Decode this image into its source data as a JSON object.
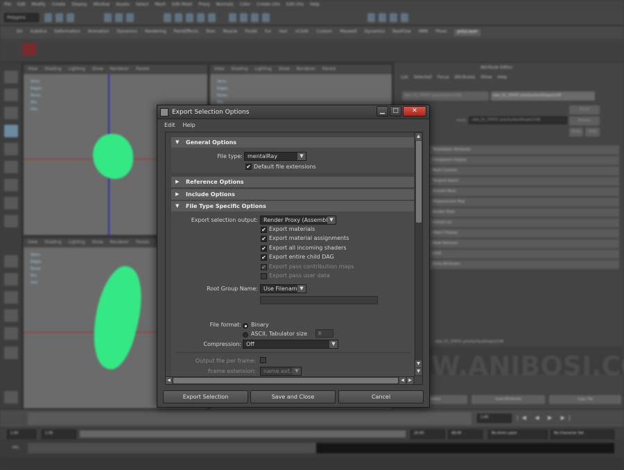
{
  "dialog": {
    "title": "Export Selection Options",
    "menu": [
      "Edit",
      "Help"
    ],
    "window_buttons": [
      "▁",
      "□",
      "✕"
    ],
    "sections": {
      "general": "General Options",
      "reference": "Reference Options",
      "include": "Include Options",
      "file_type_specific": "File Type Specific Options"
    },
    "general": {
      "file_type_label": "File type:",
      "file_type_value": "mentalRay",
      "default_extensions_label": "Default file extensions",
      "default_extensions_checked": true
    },
    "specific": {
      "export_output_label": "Export selection output:",
      "export_output_value": "Render Proxy (Assembly)",
      "checkboxes": [
        {
          "label": "Export materials",
          "checked": true,
          "enabled": true
        },
        {
          "label": "Export material assignments",
          "checked": true,
          "enabled": true
        },
        {
          "label": "Export all incoming shaders",
          "checked": true,
          "enabled": true
        },
        {
          "label": "Export entire child DAG",
          "checked": true,
          "enabled": true
        },
        {
          "label": "Export pass contribution maps",
          "checked": true,
          "enabled": false
        },
        {
          "label": "Export pass user data",
          "checked": false,
          "enabled": false
        }
      ],
      "root_group_label": "Root Group Name:",
      "root_group_value": "Use Filename",
      "file_format_label": "File format:",
      "format_binary": "Binary",
      "format_ascii": "ASCII, Tabulator size",
      "tabulator_size": "8",
      "compression_label": "Compression:",
      "compression_value": "Off",
      "output_per_frame_label": "Output file per frame:",
      "frame_extension_label": "Frame extension:",
      "frame_extension_value": "name.ext.#"
    },
    "buttons": {
      "export": "Export Selection",
      "save_close": "Save and Close",
      "cancel": "Cancel"
    }
  },
  "background": {
    "menubar": [
      "File",
      "Edit",
      "Modify",
      "Create",
      "Display",
      "Window",
      "Assets",
      "Select",
      "Mesh",
      "Edit Mesh",
      "Proxy",
      "Normals",
      "Color",
      "Create UVs",
      "Edit UVs",
      "Help"
    ],
    "status_mode": "Polygons",
    "shelf_tabs": [
      "Dir",
      "Subdivs",
      "Deformation",
      "Animation",
      "Dynamics",
      "Rendering",
      "PaintEffects",
      "Toon",
      "Muscle",
      "Fluids",
      "Fur",
      "Hair",
      "nCloth",
      "Custom",
      "Maxwell",
      "Dynamics",
      "RealFlow",
      "MRR",
      "Phoxi",
      "polyLayer"
    ],
    "active_shelf_tab": "polyLayer",
    "viewport_menu": [
      "View",
      "Shading",
      "Lighting",
      "Show",
      "Renderer",
      "Panels"
    ],
    "hud_labels": [
      "Verts:",
      "Edges:",
      "Faces:",
      "Tris:",
      "UVs:"
    ],
    "attribute_editor": {
      "title": "Attribute Editor",
      "menu": [
        "List",
        "Selected",
        "Focus",
        "Attributes",
        "Show",
        "Help"
      ],
      "tab_1": "obis_01_STATIC:polySurface2108",
      "tab_2": "obis_01_STATIC:polySurfaceShape2108",
      "shape_label": "mesh:",
      "shape_value": "obis_01_STATIC:polySurfaceShape2108",
      "rows": [
        "Tessellation Attributes",
        "Component Display",
        "Mesh Controls",
        "Tangent Space",
        "Smooth Mesh",
        "Displacement Map",
        "Render Stats",
        "mental ray",
        "Object Display",
        "Node Behavior",
        "UUID",
        "Extra Attributes"
      ],
      "bottom_buttons": [
        "Select",
        "Load Attributes",
        "Copy Tab"
      ],
      "node_label": "obis_01_STATIC:polySurfaceShape2108",
      "side_buttons": [
        "Focus",
        "Presets",
        "Show",
        "Hide"
      ]
    },
    "range": {
      "start": "1.00",
      "start2": "1.00",
      "current": "1.00",
      "end": "24.00",
      "end2": "48.00",
      "anim_layer": "No Anim Layer",
      "character": "No Character Set"
    },
    "cmd_label": "MEL",
    "watermark": "WWW.ANIBOSI.COM"
  }
}
